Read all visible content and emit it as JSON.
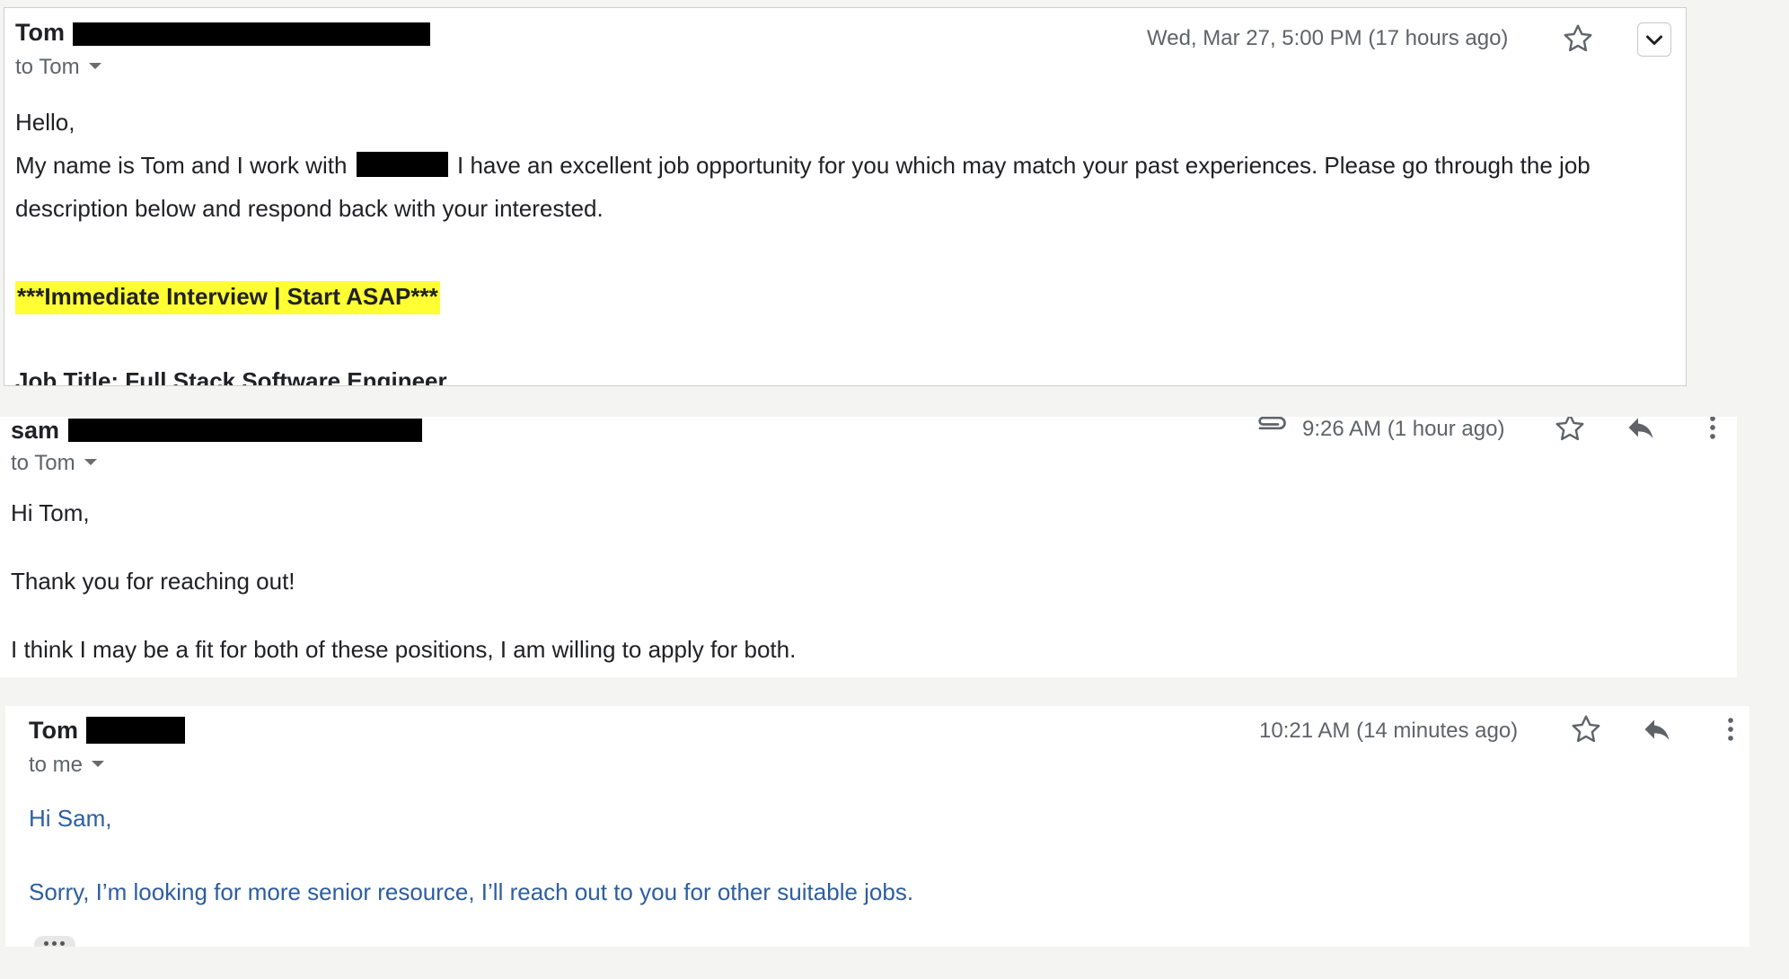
{
  "message1": {
    "sender": "Tom",
    "recipient_line": "to Tom",
    "date": "Wed, Mar 27, 5:00 PM (17 hours ago)",
    "greeting": "Hello,",
    "line1_a": "My name is Tom and I work with",
    "line1_b": "I have an excellent job opportunity for you which may match your past experiences. Please go through the job",
    "line2": "description below and respond back with your interested.",
    "highlight": "***Immediate Interview | Start ASAP***",
    "job_title": "Job Title: Full Stack Software Engineer"
  },
  "message2": {
    "sender": "sam",
    "recipient_line": "to Tom",
    "date": "9:26 AM (1 hour ago)",
    "greeting": "Hi Tom,",
    "line1": "Thank you for reaching out!",
    "line2": "I think I may be a fit for both of these positions, I am willing to apply for both."
  },
  "message3": {
    "sender": "Tom",
    "recipient_line": "to me",
    "date": "10:21 AM (14 minutes ago)",
    "greeting": "Hi Sam,",
    "line1": "Sorry, I’m looking for more senior resource, I’ll reach out to you for other suitable jobs."
  },
  "icons": {
    "star": "star-icon",
    "reply": "reply-icon",
    "more": "more-vert-icon",
    "attachment": "paperclip-icon",
    "expand": "chevron-down-icon",
    "trimmed": "ellipsis-icon"
  },
  "colors": {
    "highlight": "#ffff33",
    "reply_text": "#2d5e9e",
    "redaction": "#000000"
  }
}
